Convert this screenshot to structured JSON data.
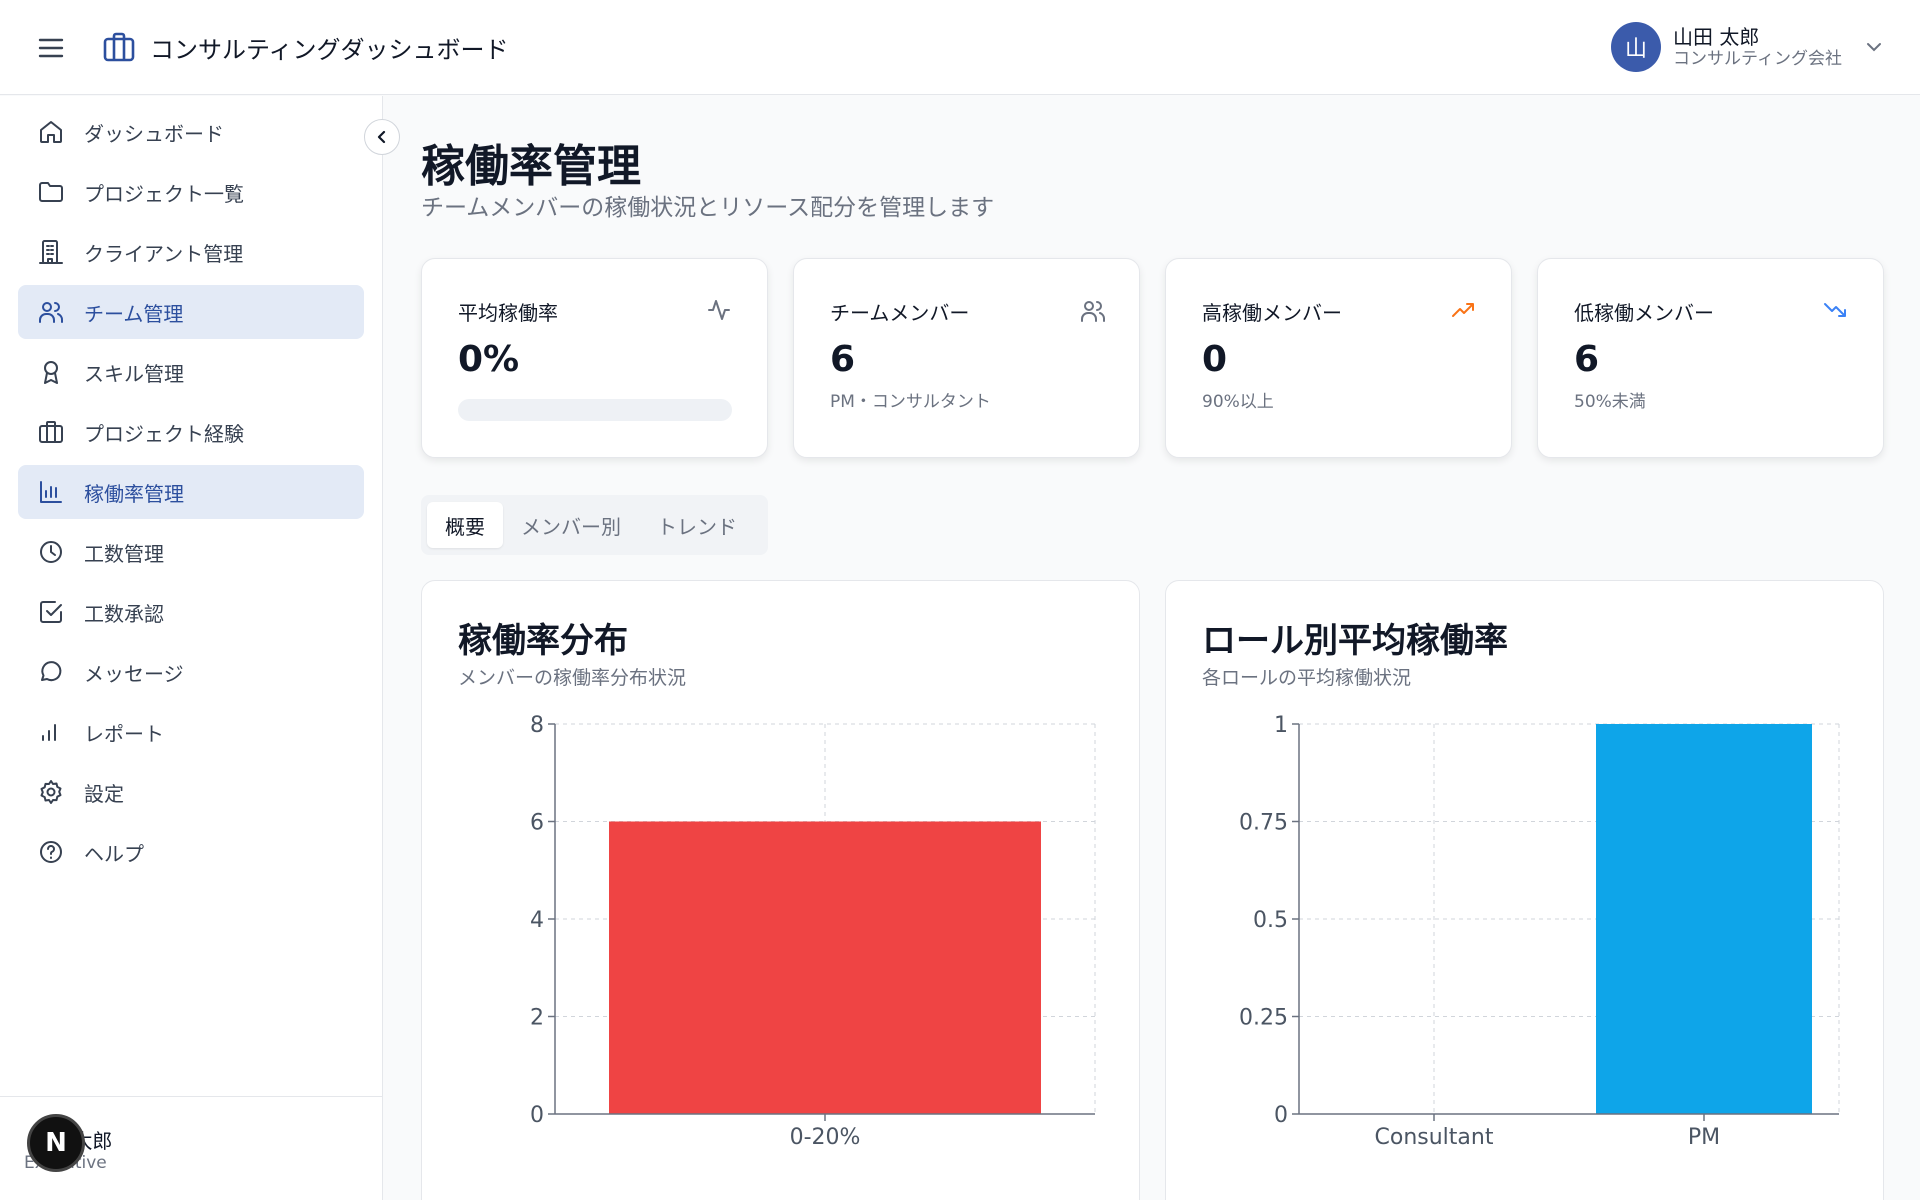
{
  "header": {
    "app_title": "コンサルティングダッシュボード",
    "user": {
      "avatar_initial": "山",
      "name": "山田 太郎",
      "company": "コンサルティング会社"
    }
  },
  "sidebar": {
    "items": [
      {
        "label": "ダッシュボード",
        "icon": "home-icon",
        "active": false
      },
      {
        "label": "プロジェクト一覧",
        "icon": "folder-icon",
        "active": false
      },
      {
        "label": "クライアント管理",
        "icon": "building-icon",
        "active": false
      },
      {
        "label": "チーム管理",
        "icon": "users-icon",
        "active": true
      },
      {
        "label": "スキル管理",
        "icon": "award-icon",
        "active": false
      },
      {
        "label": "プロジェクト経験",
        "icon": "briefcase-icon",
        "active": false
      },
      {
        "label": "稼働率管理",
        "icon": "bar-chart-icon",
        "active": true
      },
      {
        "label": "工数管理",
        "icon": "clock-icon",
        "active": false
      },
      {
        "label": "工数承認",
        "icon": "check-square-icon",
        "active": false
      },
      {
        "label": "メッセージ",
        "icon": "message-icon",
        "active": false
      },
      {
        "label": "レポート",
        "icon": "signal-icon",
        "active": false
      },
      {
        "label": "設定",
        "icon": "gear-icon",
        "active": false
      },
      {
        "label": "ヘルプ",
        "icon": "help-icon",
        "active": false
      }
    ],
    "footer": {
      "name": "山田 太郎",
      "role": "Executive"
    },
    "dev_badge": "N"
  },
  "main": {
    "title": "稼働率管理",
    "subtitle": "チームメンバーの稼働状況とリソース配分を管理します",
    "stats": [
      {
        "label": "平均稼働率",
        "value": "0%",
        "note": "",
        "icon": "activity-icon",
        "icon_color": "#6b7280",
        "progress": 0
      },
      {
        "label": "チームメンバー",
        "value": "6",
        "note": "PM・コンサルタント",
        "icon": "users-icon",
        "icon_color": "#6b7280"
      },
      {
        "label": "高稼働メンバー",
        "value": "0",
        "note": "90%以上",
        "icon": "trending-up-icon",
        "icon_color": "#f97316"
      },
      {
        "label": "低稼働メンバー",
        "value": "6",
        "note": "50%未満",
        "icon": "trending-down-icon",
        "icon_color": "#3b82f6"
      }
    ],
    "tabs": [
      {
        "label": "概要",
        "active": true
      },
      {
        "label": "メンバー別",
        "active": false
      },
      {
        "label": "トレンド",
        "active": false
      }
    ]
  },
  "chart_data": [
    {
      "type": "bar",
      "title": "稼働率分布",
      "subtitle": "メンバーの稼働率分布状況",
      "categories": [
        "0-20%"
      ],
      "values": [
        6
      ],
      "ylim": [
        0,
        8
      ],
      "yticks": [
        0,
        2,
        4,
        6,
        8
      ],
      "ytick_labels": [
        "0",
        "2",
        "4",
        "6",
        "8"
      ],
      "grid": true,
      "color": "#ef4444"
    },
    {
      "type": "bar",
      "title": "ロール別平均稼働率",
      "subtitle": "各ロールの平均稼働状況",
      "categories": [
        "Consultant",
        "PM"
      ],
      "values": [
        0,
        1
      ],
      "ylim": [
        0,
        1
      ],
      "yticks": [
        0,
        0.25,
        0.5,
        0.75,
        1
      ],
      "ytick_labels": [
        "0",
        "0.25",
        "0.5",
        "0.75",
        "1"
      ],
      "grid": true,
      "color": "#0ea5e9"
    }
  ]
}
